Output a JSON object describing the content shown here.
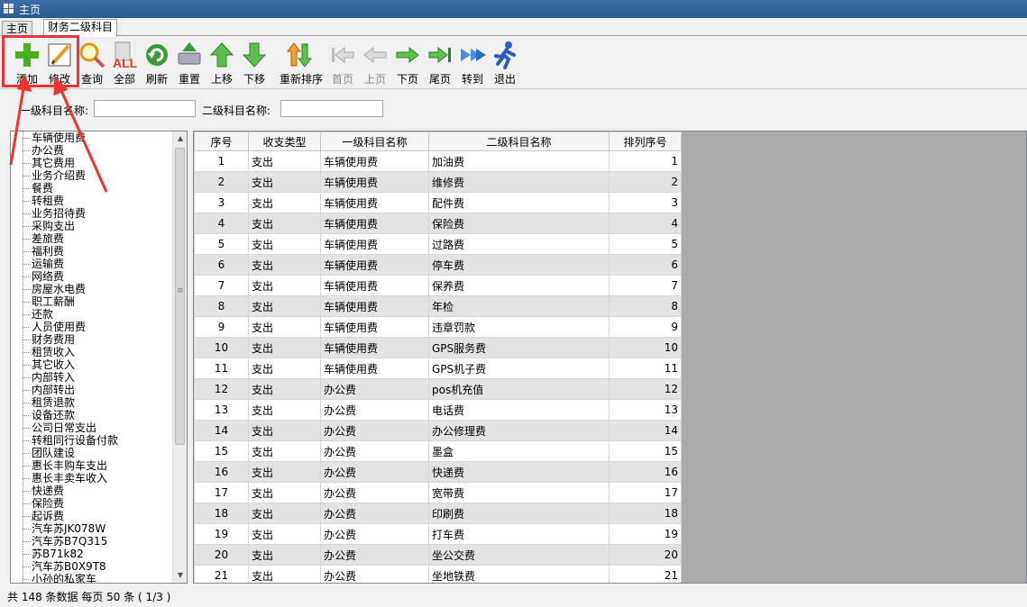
{
  "window": {
    "title": "主页"
  },
  "tabs": [
    {
      "label": "主页"
    },
    {
      "label": "财务二级科目"
    }
  ],
  "toolbar": {
    "buttons": [
      {
        "label": "添加",
        "icon": "plus-icon",
        "enabled": true
      },
      {
        "label": "修改",
        "icon": "edit-pencil-icon",
        "enabled": true
      },
      {
        "label": "查询",
        "icon": "search-icon",
        "enabled": true
      },
      {
        "label": "全部",
        "icon": "all-icon",
        "enabled": true
      },
      {
        "label": "刷新",
        "icon": "refresh-icon",
        "enabled": true
      },
      {
        "label": "重置",
        "icon": "reset-icon",
        "enabled": true
      },
      {
        "label": "上移",
        "icon": "arrow-up-icon",
        "enabled": true
      },
      {
        "label": "下移",
        "icon": "arrow-down-icon",
        "enabled": true
      },
      {
        "label": "重新排序",
        "icon": "reorder-icon",
        "enabled": true
      },
      {
        "label": "首页",
        "icon": "first-page-icon",
        "enabled": false
      },
      {
        "label": "上页",
        "icon": "prev-page-icon",
        "enabled": false
      },
      {
        "label": "下页",
        "icon": "next-page-icon",
        "enabled": true
      },
      {
        "label": "尾页",
        "icon": "last-page-icon",
        "enabled": true
      },
      {
        "label": "转到",
        "icon": "goto-icon",
        "enabled": true
      },
      {
        "label": "退出",
        "icon": "exit-runner-icon",
        "enabled": true
      }
    ]
  },
  "filters": {
    "level1_label": "一级科目名称:",
    "level1_value": "",
    "level2_label": "二级科目名称:",
    "level2_value": ""
  },
  "tree": {
    "items": [
      "车辆使用费",
      "办公费",
      "其它费用",
      "业务介绍费",
      "餐费",
      "转租费",
      "业务招待费",
      "采购支出",
      "差旅费",
      "福利费",
      "运输费",
      "网络费",
      "房屋水电费",
      "职工薪酬",
      "还款",
      "人员使用费",
      "财务费用",
      "租赁收入",
      "其它收入",
      "内部转入",
      "内部转出",
      "租赁退款",
      "设备还款",
      "公司日常支出",
      "转租同行设备付款",
      "团队建设",
      "惠长丰购车支出",
      "惠长丰卖车收入",
      "快递费",
      "保险费",
      "起诉费",
      "汽车苏JK078W",
      "汽车苏B7Q315",
      "苏B71k82",
      "汽车苏B0X9T8",
      "小孙的私家车"
    ]
  },
  "grid": {
    "columns": [
      "序号",
      "收支类型",
      "一级科目名称",
      "二级科目名称",
      "排列序号"
    ],
    "rows": [
      [
        "1",
        "支出",
        "车辆使用费",
        "加油费",
        "1"
      ],
      [
        "2",
        "支出",
        "车辆使用费",
        "维修费",
        "2"
      ],
      [
        "3",
        "支出",
        "车辆使用费",
        "配件费",
        "3"
      ],
      [
        "4",
        "支出",
        "车辆使用费",
        "保险费",
        "4"
      ],
      [
        "5",
        "支出",
        "车辆使用费",
        "过路费",
        "5"
      ],
      [
        "6",
        "支出",
        "车辆使用费",
        "停车费",
        "6"
      ],
      [
        "7",
        "支出",
        "车辆使用费",
        "保养费",
        "7"
      ],
      [
        "8",
        "支出",
        "车辆使用费",
        "年检",
        "8"
      ],
      [
        "9",
        "支出",
        "车辆使用费",
        "违章罚款",
        "9"
      ],
      [
        "10",
        "支出",
        "车辆使用费",
        "GPS服务费",
        "10"
      ],
      [
        "11",
        "支出",
        "车辆使用费",
        "GPS机子费",
        "11"
      ],
      [
        "12",
        "支出",
        "办公费",
        "pos机充值",
        "12"
      ],
      [
        "13",
        "支出",
        "办公费",
        "电话费",
        "13"
      ],
      [
        "14",
        "支出",
        "办公费",
        "办公修理费",
        "14"
      ],
      [
        "15",
        "支出",
        "办公费",
        "墨盒",
        "15"
      ],
      [
        "16",
        "支出",
        "办公费",
        "快递费",
        "16"
      ],
      [
        "17",
        "支出",
        "办公费",
        "宽带费",
        "17"
      ],
      [
        "18",
        "支出",
        "办公费",
        "印刷费",
        "18"
      ],
      [
        "19",
        "支出",
        "办公费",
        "打车费",
        "19"
      ],
      [
        "20",
        "支出",
        "办公费",
        "坐公交费",
        "20"
      ],
      [
        "21",
        "支出",
        "办公费",
        "坐地铁费",
        "21"
      ]
    ]
  },
  "status": {
    "text": "共 148 条数据  每页 50 条 ( 1/3 )"
  },
  "colors": {
    "highlight": "#e33333",
    "row_alt": "#e3e3e3",
    "grid_bg": "#ababab"
  }
}
